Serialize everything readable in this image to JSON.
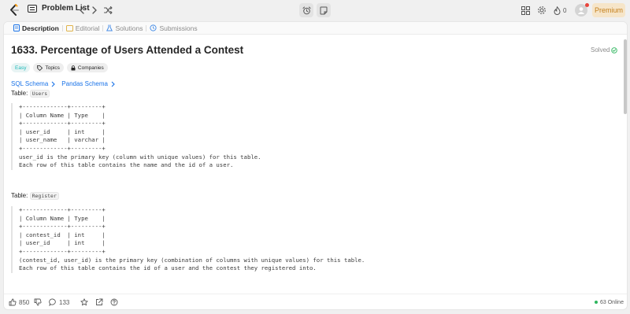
{
  "nav": {
    "problem_list_label": "Problem List",
    "streak_count": "0",
    "premium_label": "Premium"
  },
  "tabs": [
    {
      "label": "Description"
    },
    {
      "label": "Editorial"
    },
    {
      "label": "Solutions"
    },
    {
      "label": "Submissions"
    }
  ],
  "problem": {
    "title": "1633. Percentage of Users Attended a Contest",
    "status": "Solved",
    "difficulty": "Easy",
    "topics_label": "Topics",
    "companies_label": "Companies"
  },
  "schema_links": [
    "SQL Schema",
    "Pandas Schema"
  ],
  "tables": [
    {
      "prefix": "Table: ",
      "name": "Users",
      "schema": "+-------------+---------+\n| Column Name | Type    |\n+-------------+---------+\n| user_id     | int     |\n| user_name   | varchar |\n+-------------+---------+\nuser_id is the primary key (column with unique values) for this table.\nEach row of this table contains the name and the id of a user."
    },
    {
      "prefix": "Table: ",
      "name": "Register",
      "schema": "+-------------+---------+\n| Column Name | Type    |\n+-------------+---------+\n| contest_id  | int     |\n| user_id     | int     |\n+-------------+---------+\n(contest_id, user_id) is the primary key (combination of columns with unique values) for this table.\nEach row of this table contains the id of a user and the contest they registered into."
    }
  ],
  "bottom": {
    "likes": "850",
    "comments": "133",
    "online": "63 Online"
  },
  "colors": {
    "premium_bg": "#f6e5c9",
    "premium_text": "#c47f1b",
    "easy": "#1cb8b8",
    "link": "#1a73e8",
    "solved_check": "#2db55d"
  }
}
